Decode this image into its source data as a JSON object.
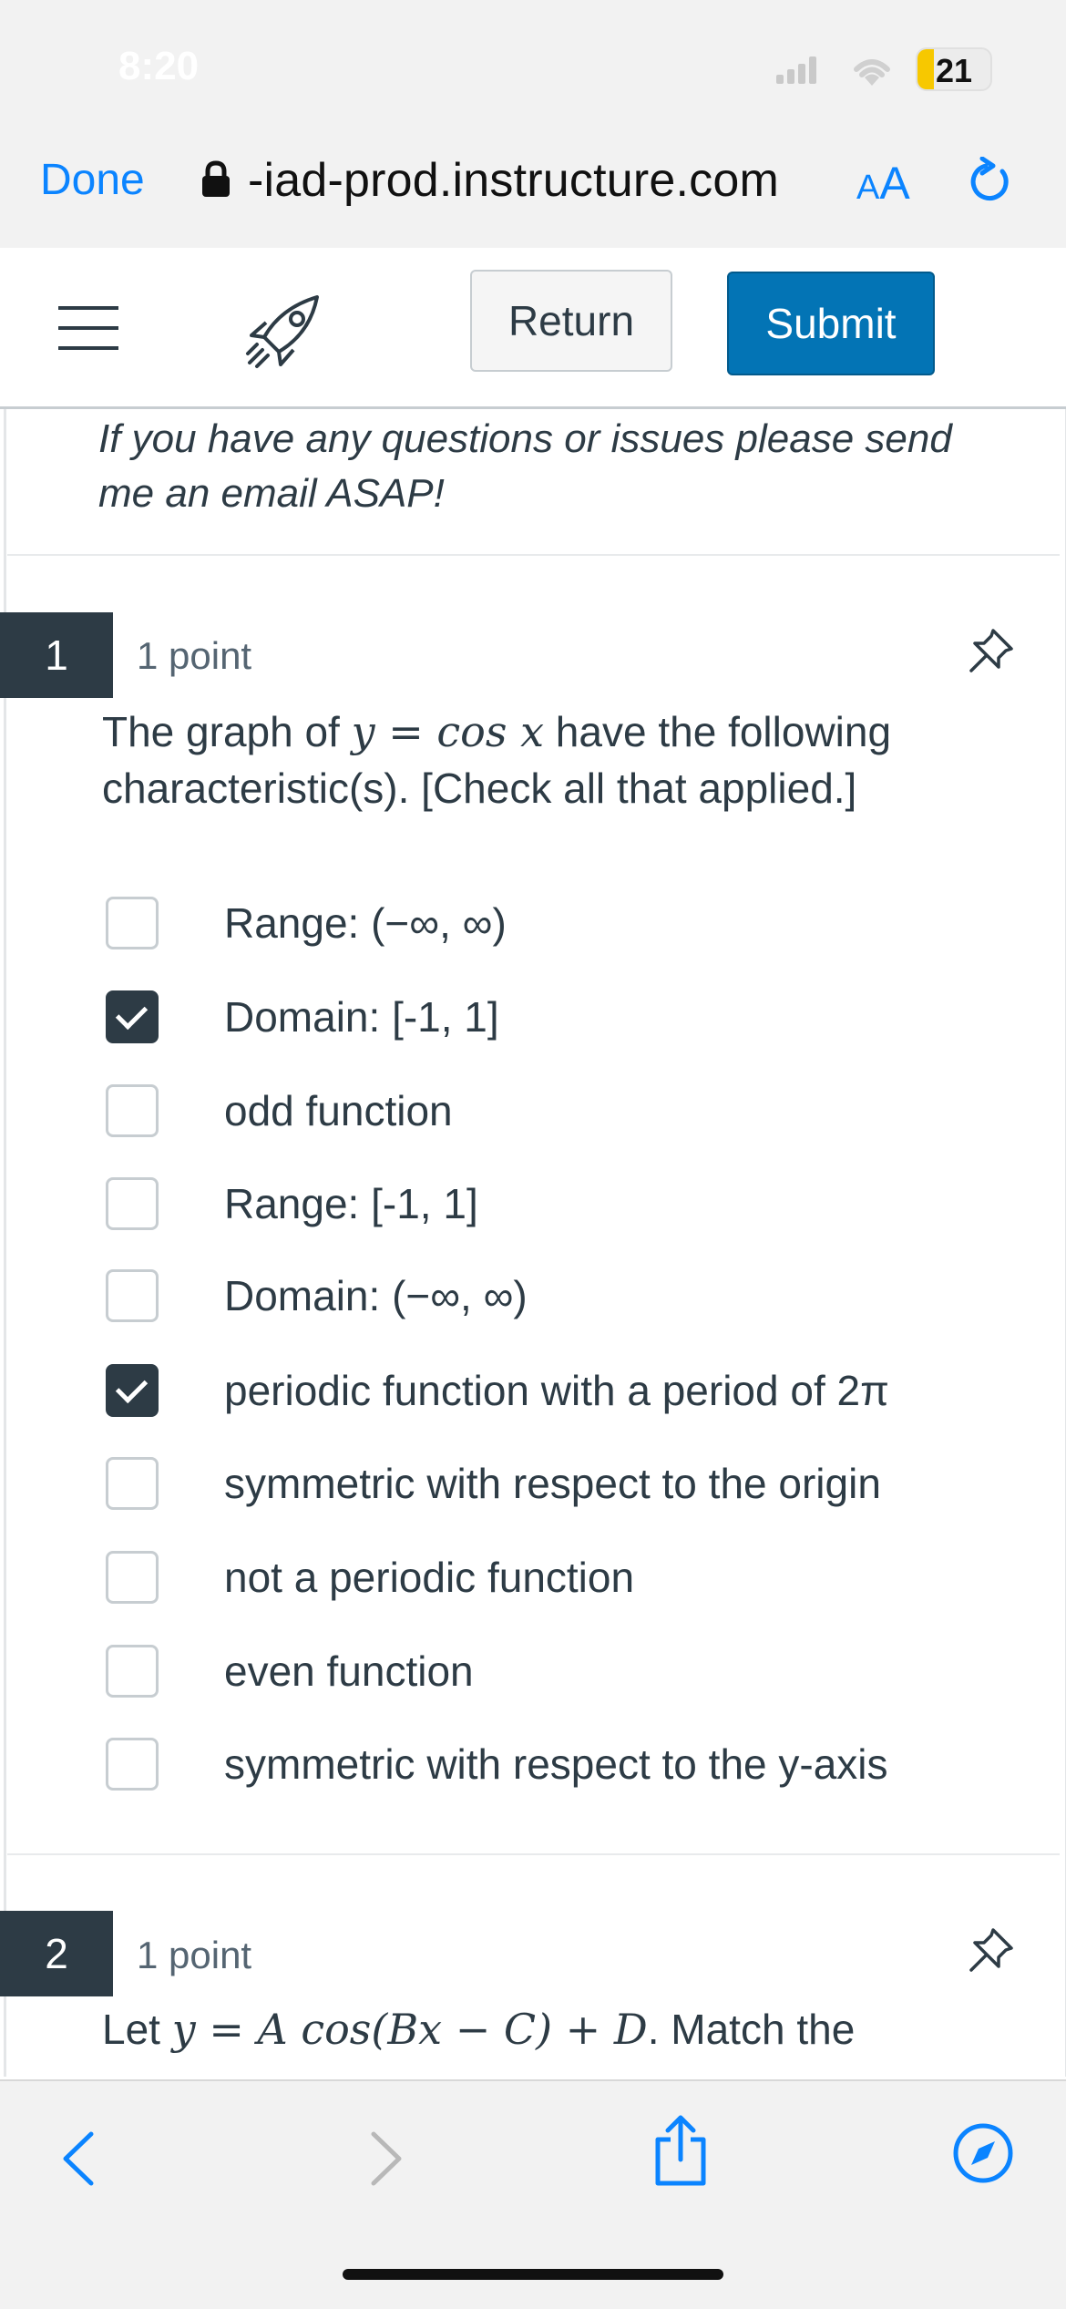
{
  "status": {
    "time": "8:20",
    "battery": "21"
  },
  "browser": {
    "done_label": "Done",
    "url": "-iad-prod.instructure.com",
    "aa_small": "A",
    "aa_big": "A"
  },
  "toolbar": {
    "return_label": "Return",
    "submit_label": "Submit"
  },
  "notice": "If you have any questions or issues please send me an email ASAP!",
  "questions": [
    {
      "number": "1",
      "points": "1 point",
      "prompt_before": "The graph of ",
      "prompt_math": "y = cos x",
      "prompt_after": " have the following characteristic(s). [Check all that applied.]",
      "options": [
        {
          "label": "Range: (−∞, ∞)",
          "checked": false
        },
        {
          "label": "Domain: [-1, 1]",
          "checked": true
        },
        {
          "label": "odd function",
          "checked": false
        },
        {
          "label": "Range: [-1, 1]",
          "checked": false
        },
        {
          "label": "Domain: (−∞, ∞)",
          "checked": false
        },
        {
          "label": "periodic function with a period of 2π",
          "checked": true
        },
        {
          "label": "symmetric with respect to the origin",
          "checked": false
        },
        {
          "label": "not a periodic function",
          "checked": false
        },
        {
          "label": "even function",
          "checked": false
        },
        {
          "label": "symmetric with respect to the y-axis",
          "checked": false
        }
      ]
    },
    {
      "number": "2",
      "points": "1 point",
      "prompt_before": "Let ",
      "prompt_math": "y = A cos(Bx − C) + D",
      "prompt_after": ". Match the"
    }
  ],
  "colors": {
    "primary": "#0374b5",
    "ios_blue": "#0b84ff",
    "dark": "#2d3b45",
    "battery": "#f7c800"
  },
  "icons": [
    "signal-icon",
    "wifi-icon",
    "battery-icon",
    "lock-icon",
    "reload-icon",
    "hamburger-menu-icon",
    "rocket-icon",
    "pin-icon",
    "back-icon",
    "forward-icon",
    "share-icon",
    "compass-icon"
  ]
}
